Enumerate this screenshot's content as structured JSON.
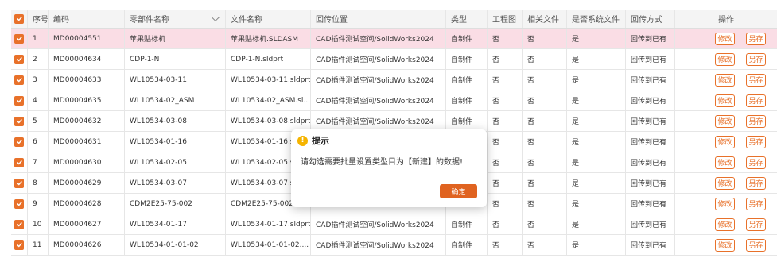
{
  "table": {
    "headers": {
      "seq": "序号",
      "code": "编码",
      "part_name": "零部件名称",
      "file_name": "文件名称",
      "location": "回传位置",
      "type": "类型",
      "drawing": "工程图",
      "related": "相关文件",
      "system_file": "是否系统文件",
      "method": "回传方式",
      "ops": "操作"
    },
    "edit_label": "修改",
    "saveas_label": "另存",
    "rows": [
      {
        "seq": "1",
        "code": "MD00004551",
        "part_name": "苹果贴标机",
        "file_name": "苹果贴标机.SLDASM",
        "location": "CAD插件测试空间/SolidWorks2024",
        "type": "自制件",
        "drawing": "否",
        "related": "否",
        "system_file": "是",
        "method": "回传到已有"
      },
      {
        "seq": "2",
        "code": "MD00004634",
        "part_name": "CDP-1-N",
        "file_name": "CDP-1-N.sldprt",
        "location": "CAD插件测试空间/SolidWorks2024",
        "type": "自制件",
        "drawing": "否",
        "related": "否",
        "system_file": "是",
        "method": "回传到已有"
      },
      {
        "seq": "3",
        "code": "MD00004633",
        "part_name": "WL10534-03-11",
        "file_name": "WL10534-03-11.sldprt",
        "location": "CAD插件测试空间/SolidWorks2024",
        "type": "自制件",
        "drawing": "否",
        "related": "否",
        "system_file": "是",
        "method": "回传到已有"
      },
      {
        "seq": "4",
        "code": "MD00004635",
        "part_name": "WL10534-02_ASM",
        "file_name": "WL10534-02_ASM.sl...",
        "location": "CAD插件测试空间/SolidWorks2024",
        "type": "自制件",
        "drawing": "否",
        "related": "否",
        "system_file": "是",
        "method": "回传到已有"
      },
      {
        "seq": "5",
        "code": "MD00004632",
        "part_name": "WL10534-03-08",
        "file_name": "WL10534-03-08.sldprt",
        "location": "CAD插件测试空间/SolidWorks2024",
        "type": "自制件",
        "drawing": "否",
        "related": "否",
        "system_file": "是",
        "method": "回传到已有"
      },
      {
        "seq": "6",
        "code": "MD00004631",
        "part_name": "WL10534-01-16",
        "file_name": "WL10534-01-16.sld",
        "location": "",
        "type": "",
        "drawing": "否",
        "related": "否",
        "system_file": "是",
        "method": "回传到已有"
      },
      {
        "seq": "7",
        "code": "MD00004630",
        "part_name": "WL10534-02-05",
        "file_name": "WL10534-02-05.sld",
        "location": "",
        "type": "",
        "drawing": "否",
        "related": "否",
        "system_file": "是",
        "method": "回传到已有"
      },
      {
        "seq": "8",
        "code": "MD00004629",
        "part_name": "WL10534-03-07",
        "file_name": "WL10534-03-07.sld",
        "location": "",
        "type": "",
        "drawing": "否",
        "related": "否",
        "system_file": "是",
        "method": "回传到已有"
      },
      {
        "seq": "9",
        "code": "MD00004628",
        "part_name": "CDM2E25-75-002",
        "file_name": "CDM2E25-75-002.sl...",
        "location": "",
        "type": "",
        "drawing": "否",
        "related": "否",
        "system_file": "是",
        "method": "回传到已有"
      },
      {
        "seq": "10",
        "code": "MD00004627",
        "part_name": "WL10534-01-17",
        "file_name": "WL10534-01-17.sldprt",
        "location": "CAD插件测试空间/SolidWorks2024",
        "type": "自制件",
        "drawing": "否",
        "related": "否",
        "system_file": "是",
        "method": "回传到已有"
      },
      {
        "seq": "11",
        "code": "MD00004626",
        "part_name": "WL10534-01-01-02",
        "file_name": "WL10534-01-01-02....",
        "location": "CAD插件测试空间/SolidWorks2024",
        "type": "自制件",
        "drawing": "否",
        "related": "否",
        "system_file": "是",
        "method": "回传到已有"
      }
    ]
  },
  "dialog": {
    "title": "提示",
    "icon": "warning-icon",
    "message": "请勾选需要批量设置类型目为【新建】的数据!",
    "ok_label": "确定"
  },
  "colors": {
    "accent": "#e8712a",
    "selected_row": "#fadde5",
    "ok_button": "#e06320",
    "warning": "#f5b400"
  }
}
